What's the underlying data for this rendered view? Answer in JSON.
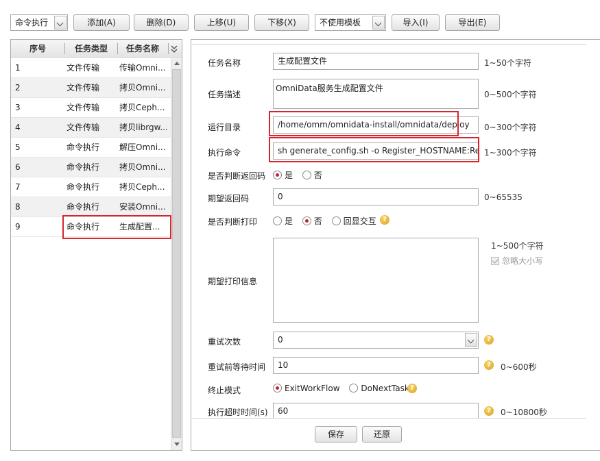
{
  "toolbar": {
    "task_type_select": "命令执行",
    "add": "添加(A)",
    "delete": "删除(D)",
    "move_up": "上移(U)",
    "move_down": "下移(X)",
    "template_select": "不使用模板",
    "import": "导入(I)",
    "export": "导出(E)"
  },
  "task_table": {
    "columns": [
      "序号",
      "任务类型",
      "任务名称"
    ],
    "rows": [
      {
        "no": "1",
        "type": "文件传输",
        "name": "传输Omni..."
      },
      {
        "no": "2",
        "type": "文件传输",
        "name": "拷贝Omni..."
      },
      {
        "no": "3",
        "type": "文件传输",
        "name": "拷贝Ceph..."
      },
      {
        "no": "4",
        "type": "文件传输",
        "name": "拷贝librgw..."
      },
      {
        "no": "5",
        "type": "命令执行",
        "name": "解压Omni..."
      },
      {
        "no": "6",
        "type": "命令执行",
        "name": "拷贝Omni..."
      },
      {
        "no": "7",
        "type": "命令执行",
        "name": "拷贝Ceph..."
      },
      {
        "no": "8",
        "type": "命令执行",
        "name": "安装Omni..."
      },
      {
        "no": "9",
        "type": "命令执行",
        "name": "生成配置..."
      }
    ]
  },
  "form": {
    "task_name": {
      "label": "任务名称",
      "value": "生成配置文件",
      "hint": "1~50个字符"
    },
    "task_desc": {
      "label": "任务描述",
      "value": "OmniData服务生成配置文件",
      "hint": "0~500个字符"
    },
    "run_dir": {
      "label": "运行目录",
      "value": "/home/omm/omnidata-install/omnidata/deploy",
      "hint": "0~300个字符"
    },
    "exec_cmd": {
      "label": "执行命令",
      "value": "sh generate_config.sh -o Register_HOSTNAME:Regi:",
      "hint": "1~300个字符"
    },
    "check_return": {
      "label": "是否判断返回码",
      "options": [
        "是",
        "否"
      ],
      "selected": "是"
    },
    "expected_return": {
      "label": "期望返回码",
      "value": "0",
      "hint": "0~65535"
    },
    "check_print": {
      "label": "是否判断打印",
      "options": [
        "是",
        "否",
        "回显交互"
      ],
      "selected": "否"
    },
    "expected_print": {
      "label": "期望打印信息",
      "value": "",
      "hint": "1~500个字符",
      "ignore_case": "忽略大小写",
      "ignore_case_checked": true
    },
    "retry_count": {
      "label": "重试次数",
      "value": "0"
    },
    "retry_wait": {
      "label": "重试前等待时间",
      "value": "10",
      "hint": "0~600秒"
    },
    "stop_mode": {
      "label": "终止模式",
      "options": [
        "ExitWorkFlow",
        "DoNextTask"
      ],
      "selected": "ExitWorkFlow"
    },
    "exec_timeout": {
      "label": "执行超时时间(s)",
      "value": "60",
      "hint": "0~10800秒"
    }
  },
  "footer": {
    "save": "保存",
    "reset": "还原"
  },
  "colors": {
    "highlight_box": "#d9232d",
    "radio_selected": "#c8232c",
    "help_icon": "#e2ae2b"
  }
}
